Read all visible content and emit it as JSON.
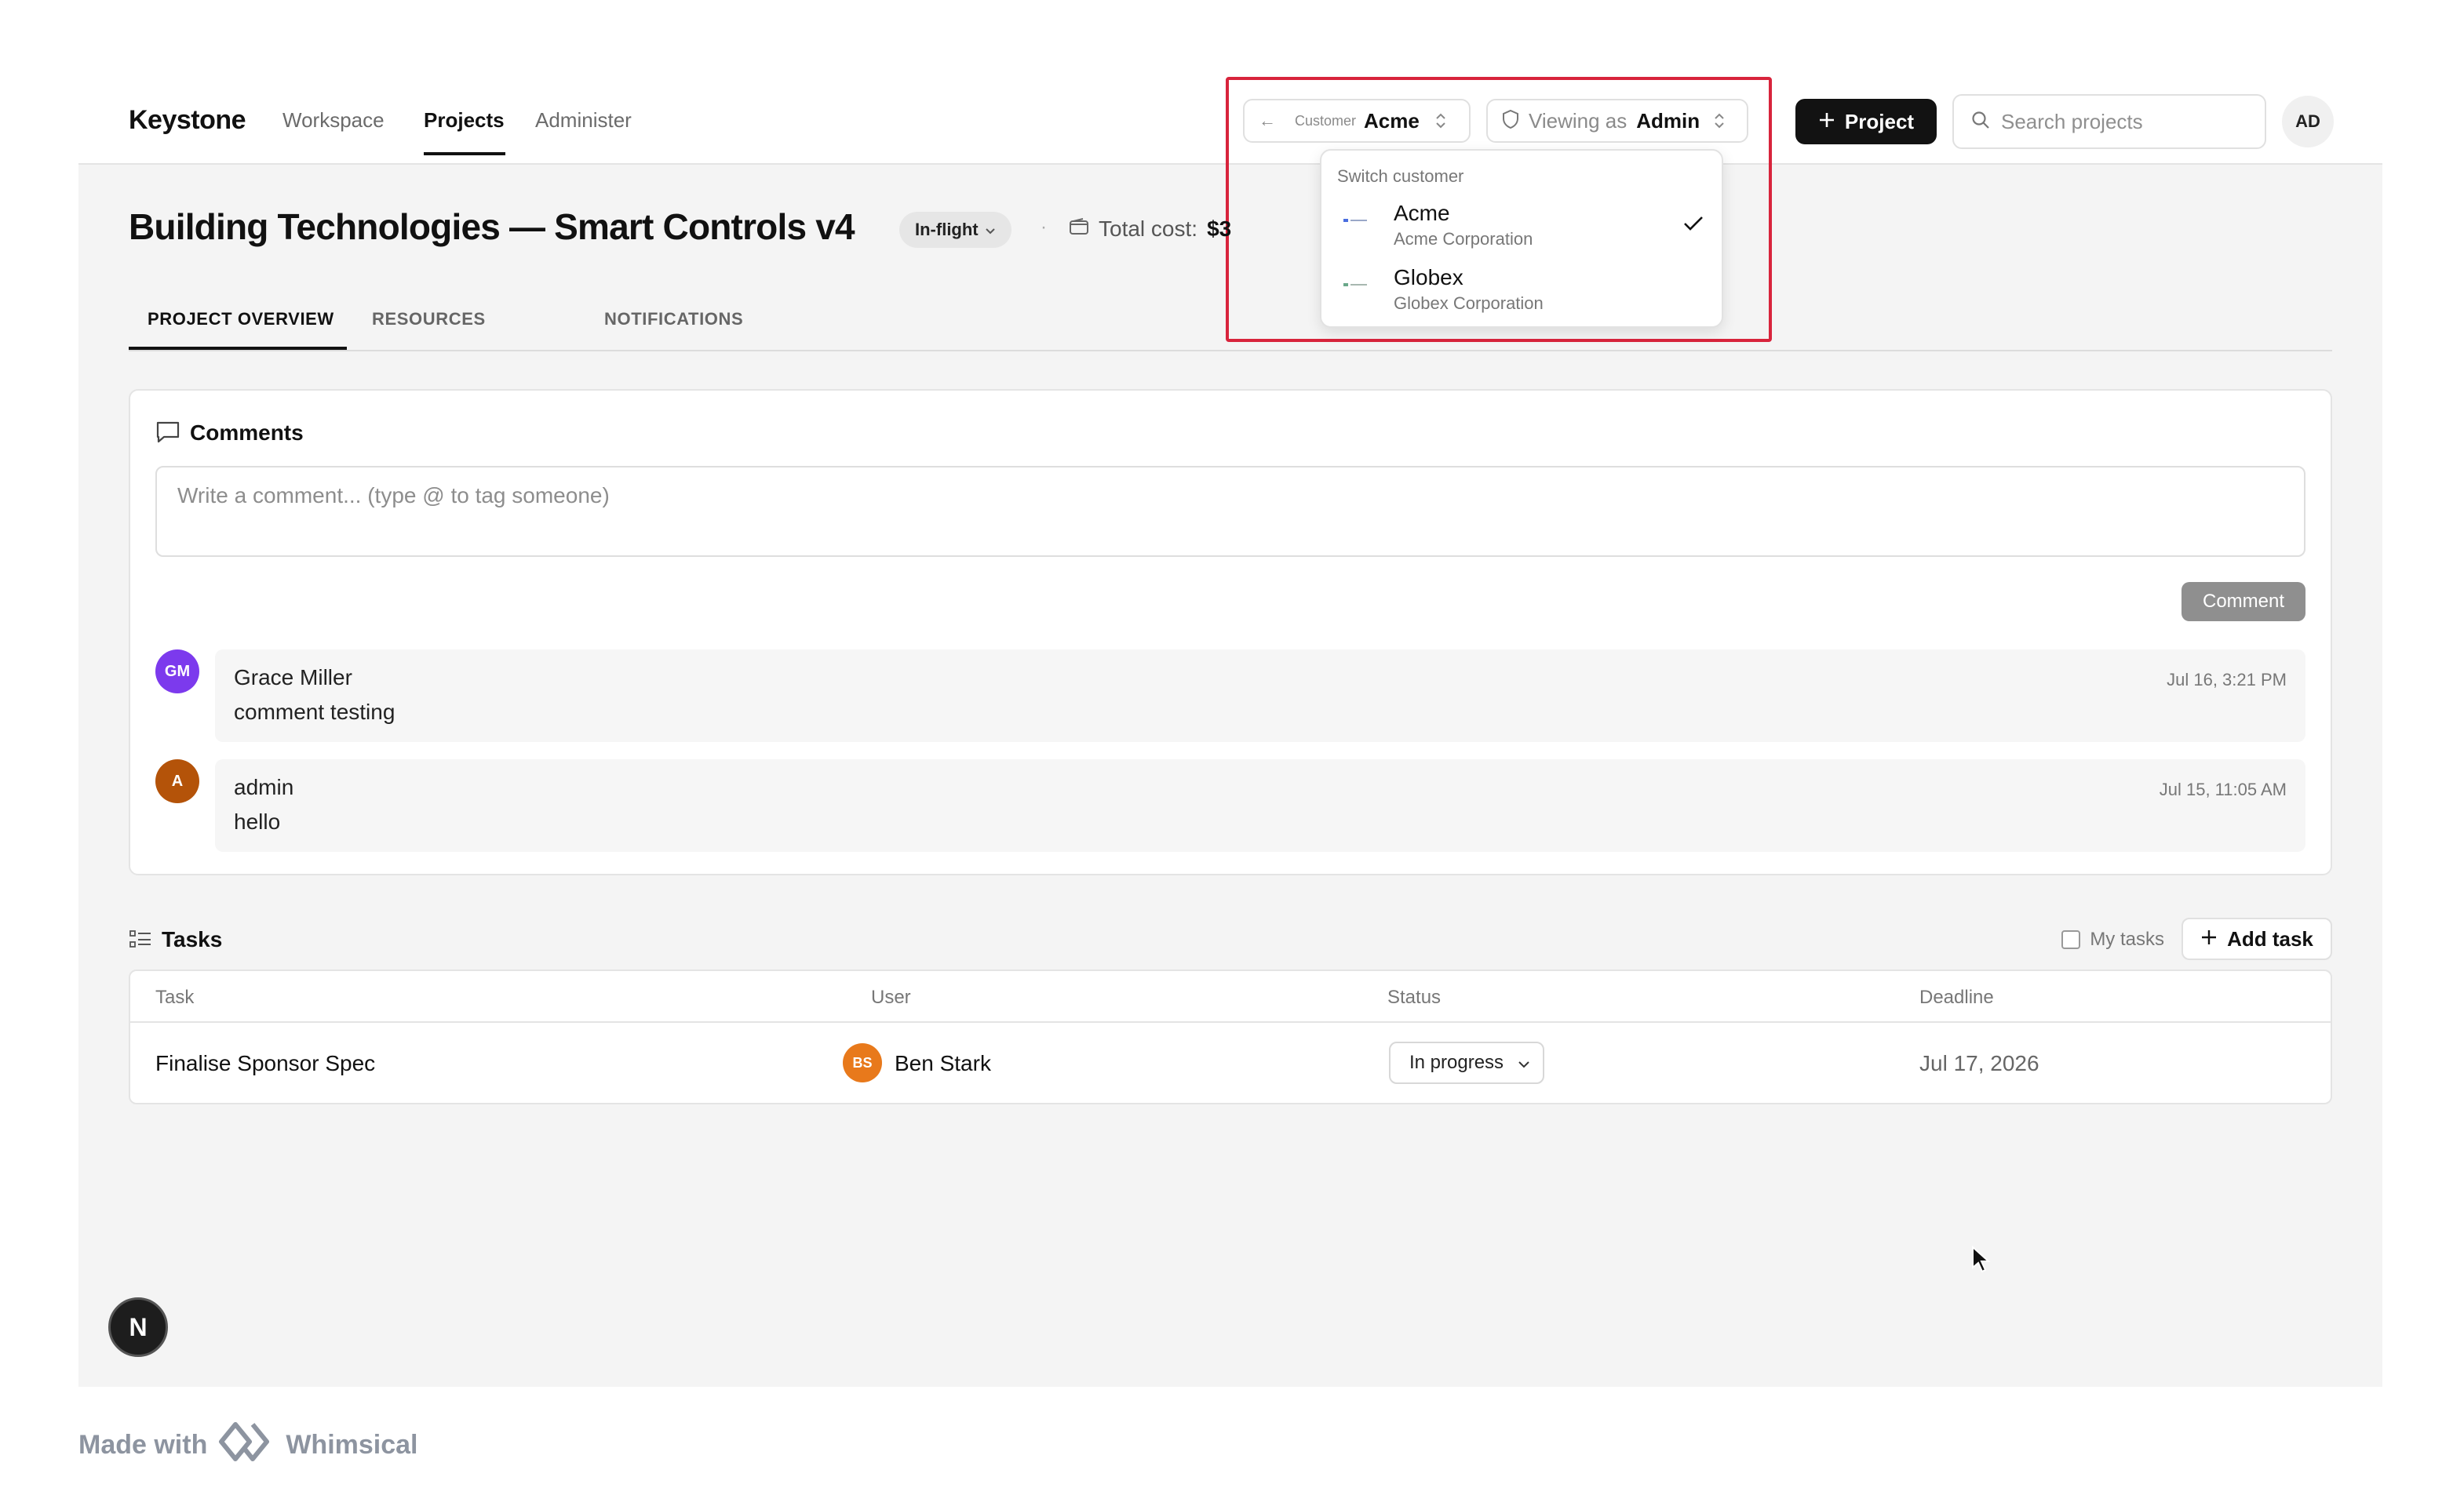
{
  "header": {
    "brand": "Keystone",
    "nav": [
      {
        "label": "Workspace"
      },
      {
        "label": "Projects"
      },
      {
        "label": "Administer"
      }
    ],
    "customer_selector": {
      "back_arrow": "←",
      "label": "Customer",
      "value": "Acme"
    },
    "role_selector": {
      "label": "Viewing as",
      "value": "Admin"
    },
    "new_project_label": "Project",
    "search": {
      "placeholder": "Search projects",
      "value": ""
    },
    "user_initials": "AD"
  },
  "customer_dropdown": {
    "heading": "Switch customer",
    "items": [
      {
        "name": "Acme",
        "subtitle": "Acme Corporation",
        "selected": true
      },
      {
        "name": "Globex",
        "subtitle": "Globex Corporation",
        "selected": false
      }
    ]
  },
  "project": {
    "title": "Building Technologies — Smart Controls v4",
    "status": "In-flight",
    "separator": "·",
    "cost_label": "Total cost:",
    "cost_value": "$3"
  },
  "tabs": [
    {
      "label": "PROJECT OVERVIEW",
      "active": true
    },
    {
      "label": "RESOURCES",
      "active": false
    },
    {
      "label": "NOTIFICATIONS",
      "active": false
    }
  ],
  "comments": {
    "title": "Comments",
    "placeholder": "Write a comment... (type @ to tag someone)",
    "submit_label": "Comment",
    "items": [
      {
        "initials": "GM",
        "author": "Grace Miller",
        "body": "comment testing",
        "time": "Jul 16, 3:21 PM",
        "avatar_color": "#7c3aed"
      },
      {
        "initials": "A",
        "author": "admin",
        "body": "hello",
        "time": "Jul 15, 11:05 AM",
        "avatar_color": "#b45309"
      }
    ]
  },
  "tasks": {
    "title": "Tasks",
    "my_tasks_label": "My tasks",
    "add_task_label": "Add task",
    "columns": [
      "Task",
      "User",
      "Status",
      "Deadline"
    ],
    "rows": [
      {
        "task": "Finalise Sponsor Spec",
        "user_initials": "BS",
        "user": "Ben Stark",
        "status": "In progress",
        "deadline": "Jul 17, 2026"
      }
    ]
  },
  "next_badge": "N",
  "footer": {
    "made_with": "Made with",
    "product": "Whimsical"
  },
  "colors": {
    "highlight": "#d8243c",
    "primary_button": "#121212",
    "comment_button": "#8f8f8f",
    "task_user_avatar": "#e8791b"
  }
}
